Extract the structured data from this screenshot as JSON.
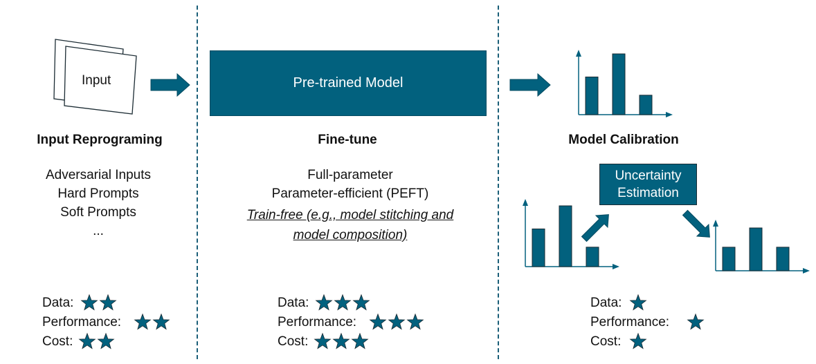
{
  "colors": {
    "primary": "#02617e",
    "dark": "#034a60",
    "divider": "#1a5e78"
  },
  "input_card": {
    "label": "Input"
  },
  "model_box": {
    "label": "Pre-trained Model"
  },
  "uncertainty_box": {
    "line1": "Uncertainty",
    "line2": "Estimation"
  },
  "sections": {
    "input_reprogramming": {
      "title": "Input Reprograming",
      "items": [
        "Adversarial Inputs",
        "Hard Prompts",
        "Soft Prompts",
        "..."
      ],
      "ratings": {
        "data_label": "Data:",
        "data_stars": 2,
        "performance_label": "Performance:",
        "performance_stars": 2,
        "cost_label": "Cost:",
        "cost_stars": 2
      }
    },
    "fine_tune": {
      "title": "Fine-tune",
      "items": [
        "Full-parameter",
        "Parameter-efficient (PEFT)"
      ],
      "italic_line1": "Train-free (e.g., model stitching and",
      "italic_line2": "model composition)",
      "ratings": {
        "data_label": "Data:",
        "data_stars": 3,
        "performance_label": "Performance:",
        "performance_stars": 3,
        "cost_label": "Cost:",
        "cost_stars": 3
      }
    },
    "model_calibration": {
      "title": "Model Calibration",
      "ratings": {
        "data_label": "Data:",
        "data_stars": 1,
        "performance_label": "Performance:",
        "performance_stars": 1,
        "cost_label": "Cost:",
        "cost_stars": 1
      }
    }
  },
  "icons": {
    "arrow": "right-arrow-icon",
    "star": "star-icon",
    "bar_chart": "bar-chart-icon"
  },
  "bar_charts": {
    "top": [
      0.62,
      1.0,
      0.32
    ],
    "left": [
      0.62,
      1.0,
      0.32
    ],
    "right": [
      0.55,
      1.0,
      0.55
    ]
  }
}
